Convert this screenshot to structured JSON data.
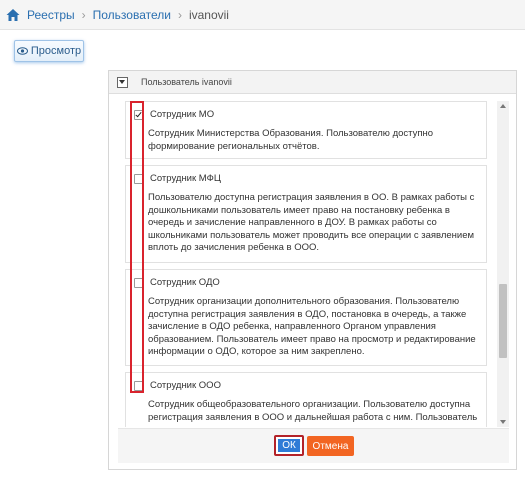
{
  "breadcrumb": {
    "items": [
      "Реестры",
      "Пользователи"
    ],
    "current": "ivanovii"
  },
  "toolbar": {
    "view_label": "Просмотр"
  },
  "panel": {
    "title": "Пользователь ivanovii"
  },
  "roles": [
    {
      "title": "Сотрудник МО",
      "checked": true,
      "description": "Сотрудник Министерства Образования. Пользователю доступно формирование региональных отчётов."
    },
    {
      "title": "Сотрудник МФЦ",
      "checked": false,
      "description": "Пользователю доступна регистрация заявления в ОО. В рамках работы с дошкольниками пользователь имеет право на постановку ребенка в очередь и зачисление направленного в ДОУ. В рамках работы со школьниками пользователь может проводить все операции с заявлением вплоть до зачисления ребенка в ООО."
    },
    {
      "title": "Сотрудник ОДО",
      "checked": false,
      "description": "Сотрудник организации дополнительного образования. Пользователю доступна регистрация заявления в ОДО, постановка в очередь, а также зачисление в ОДО ребенка, направленного Органом управления образованием. Пользователь имеет право на просмотр и редактирование информации о ОДО, которое за ним закреплено."
    },
    {
      "title": "Сотрудник ООО",
      "checked": false,
      "description": "Сотрудник общеобразовательного организации. Пользователю доступна регистрация заявления в ООО и дальнейшая работа с ним. Пользователь"
    }
  ],
  "footer": {
    "ok_label": "ОК",
    "cancel_label": "Отмена"
  },
  "colors": {
    "accent": "#2e7bd6",
    "cancel": "#f26522",
    "highlight": "#d9232d",
    "link": "#2a6fb0"
  },
  "icons": {
    "home": "home-icon",
    "view": "eye-icon",
    "collapse": "collapse-icon"
  }
}
